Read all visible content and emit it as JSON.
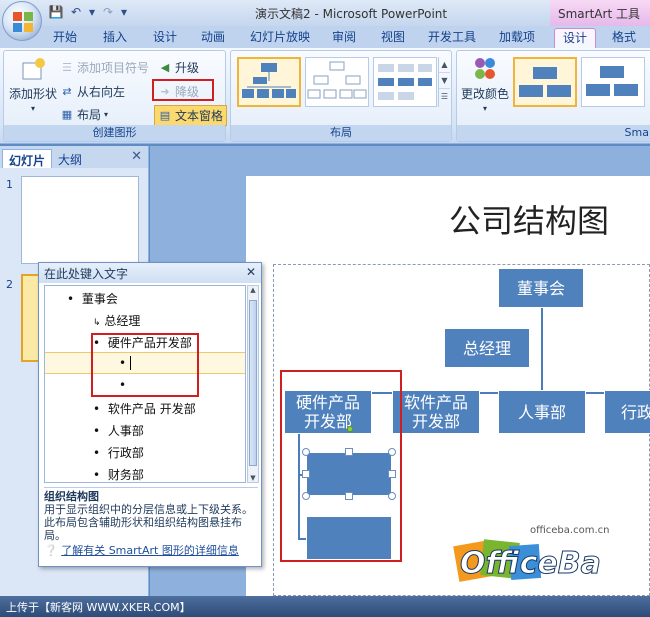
{
  "window": {
    "title": "演示文稿2 - Microsoft PowerPoint",
    "contextual_title": "SmartArt 工具"
  },
  "tabs": [
    "开始",
    "插入",
    "设计",
    "动画",
    "幻灯片放映",
    "审阅",
    "视图",
    "开发工具",
    "加载项",
    "设计",
    "格式"
  ],
  "ribbon": {
    "create_graphic": {
      "label": "创建图形",
      "add_shape": "添加形状",
      "add_bullet": "添加项目符号",
      "right_to_left": "从右向左",
      "layout": "布局",
      "promote": "升级",
      "demote": "降级",
      "text_pane": "文本窗格"
    },
    "layouts": {
      "label": "布局"
    },
    "styles": {
      "change_colors": "更改颜色",
      "label": "Sma"
    }
  },
  "left_pane": {
    "tabs": [
      "幻灯片",
      "大纲"
    ],
    "slide_numbers": [
      "1",
      "2"
    ]
  },
  "slide": {
    "title": "公司结构图",
    "org_chart": {
      "top": "董事会",
      "manager": "总经理",
      "departments": [
        "硬件产品开发部",
        "软件产品开发部",
        "人事部",
        "行政"
      ]
    }
  },
  "text_pane": {
    "header": "在此处键入文字",
    "items": [
      "董事会",
      "总经理",
      "硬件产品开发部",
      "",
      "",
      "软件产品 开发部",
      "人事部",
      "行政部",
      "财务部"
    ],
    "description_title": "组织结构图",
    "description": "用于显示组织中的分层信息或上下级关系。此布局包含辅助形状和组织结构图悬挂布局。",
    "link": "了解有关 SmartArt 图形的详细信息"
  },
  "status_bar": {
    "text": "上传于【新客网 WWW.XKER.COM】"
  },
  "watermark": {
    "url": "officeba.com.cn",
    "logo": "OfficeBa"
  },
  "colors": {
    "node": "#4f81bd",
    "highlight": "#d11f1f",
    "ribbon": "#d6e4f6"
  }
}
